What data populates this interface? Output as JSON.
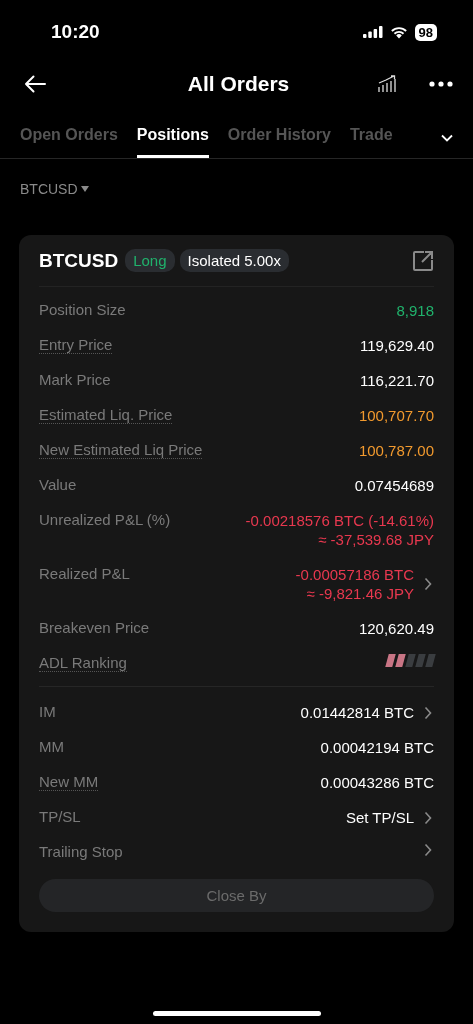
{
  "status_bar": {
    "time": "10:20",
    "battery": "98"
  },
  "header": {
    "title": "All Orders"
  },
  "tabs": [
    {
      "label": "Open Orders",
      "selected": false
    },
    {
      "label": "Positions",
      "selected": true
    },
    {
      "label": "Order History",
      "selected": false
    },
    {
      "label": "Trade",
      "selected": false
    }
  ],
  "filter": {
    "label": "BTCUSD"
  },
  "card": {
    "symbol": "BTCUSD",
    "side": {
      "label": "Long",
      "color": "#20b26c"
    },
    "margin_mode": "Isolated 5.00x",
    "sections": [
      {
        "rows": [
          {
            "kind": "value",
            "label": "Position Size",
            "dotted": false,
            "values": [
              "8,918"
            ],
            "color": "#20b26c",
            "chevron": false
          },
          {
            "kind": "value",
            "label": "Entry Price",
            "dotted": true,
            "values": [
              "119,629.40"
            ],
            "color": "#ffffff",
            "chevron": false
          },
          {
            "kind": "value",
            "label": "Mark Price",
            "dotted": false,
            "values": [
              "116,221.70"
            ],
            "color": "#ffffff",
            "chevron": false
          },
          {
            "kind": "value",
            "label": "Estimated Liq. Price",
            "dotted": true,
            "values": [
              "100,707.70"
            ],
            "color": "#f29a2e",
            "chevron": false
          },
          {
            "kind": "value",
            "label": "New Estimated Liq Price",
            "dotted": true,
            "values": [
              "100,787.00"
            ],
            "color": "#f29a2e",
            "chevron": false
          },
          {
            "kind": "value",
            "label": "Value",
            "dotted": false,
            "values": [
              "0.07454689"
            ],
            "color": "#ffffff",
            "chevron": false
          },
          {
            "kind": "value",
            "label": "Unrealized P&L (%)",
            "dotted": false,
            "values": [
              "-0.00218576 BTC (-14.61%)",
              "≈ -37,539.68 JPY"
            ],
            "color": "#e8384f",
            "chevron": false
          },
          {
            "kind": "value",
            "label": "Realized P&L",
            "dotted": false,
            "values": [
              "-0.00057186 BTC",
              "≈ -9,821.46 JPY"
            ],
            "color": "#e8384f",
            "chevron": true
          },
          {
            "kind": "value",
            "label": "Breakeven Price",
            "dotted": false,
            "values": [
              "120,620.49"
            ],
            "color": "#ffffff",
            "chevron": false
          },
          {
            "kind": "meter",
            "label": "ADL Ranking",
            "dotted": true,
            "level": 0.4
          }
        ]
      },
      {
        "rows": [
          {
            "kind": "value",
            "label": "IM",
            "dotted": false,
            "values": [
              "0.01442814 BTC"
            ],
            "color": "#ffffff",
            "chevron": true
          },
          {
            "kind": "value",
            "label": "MM",
            "dotted": false,
            "values": [
              "0.00042194 BTC"
            ],
            "color": "#ffffff",
            "chevron": false
          },
          {
            "kind": "value",
            "label": "New MM",
            "dotted": true,
            "values": [
              "0.00043286 BTC"
            ],
            "color": "#ffffff",
            "chevron": false
          },
          {
            "kind": "value",
            "label": "TP/SL",
            "dotted": false,
            "values": [
              "Set TP/SL"
            ],
            "color": "#ffffff",
            "chevron": true
          },
          {
            "kind": "value",
            "label": "Trailing Stop",
            "dotted": false,
            "chevron": true
          }
        ]
      }
    ],
    "button": {
      "label": "Close By",
      "disabled": true
    }
  }
}
